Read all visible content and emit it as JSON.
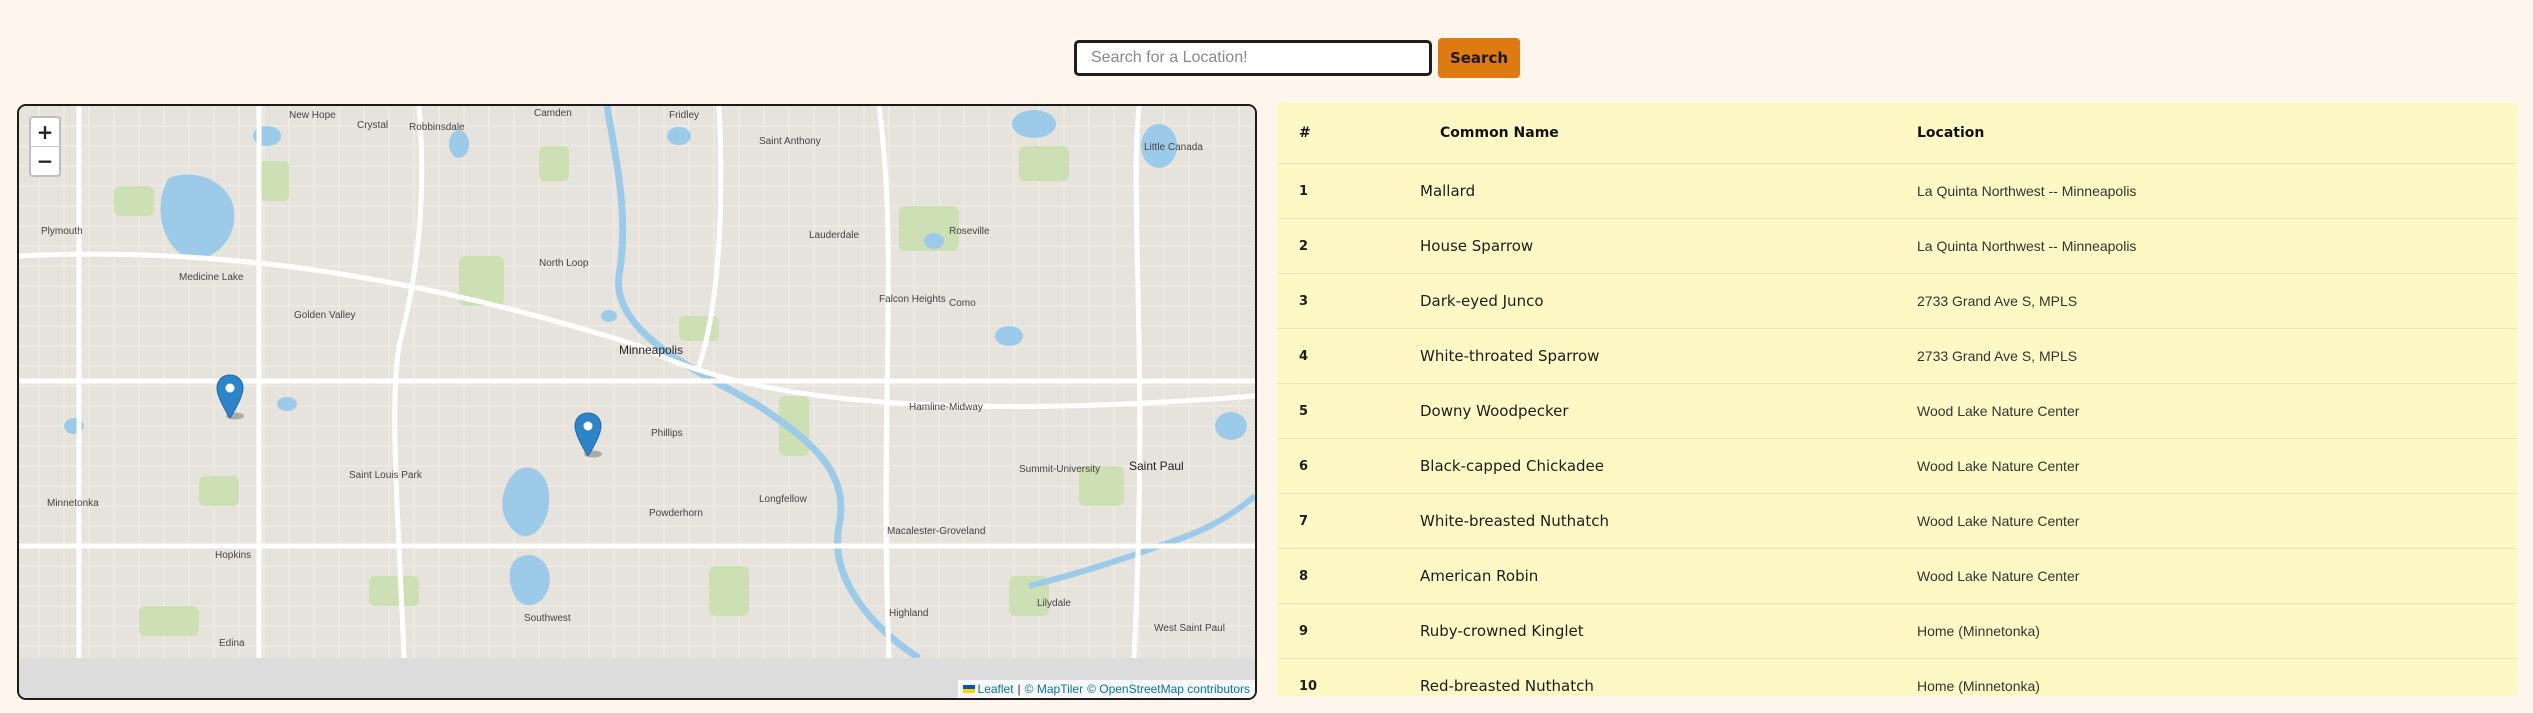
{
  "search": {
    "placeholder": "Search for a Location!",
    "button_label": "Search"
  },
  "map": {
    "zoom_in_label": "+",
    "zoom_out_label": "−",
    "attribution": {
      "leaflet": "Leaflet",
      "separator": "|",
      "copyright_1": "© MapTiler",
      "copyright_2": "© OpenStreetMap contributors"
    },
    "labels": {
      "new_hope": "New Hope",
      "crystal": "Crystal",
      "robbinsdale": "Robbinsdale",
      "camden": "Camden",
      "fridley": "Fridley",
      "saint_anthony": "Saint Anthony",
      "little_canada": "Little Canada",
      "plymouth": "Plymouth",
      "medicine_lake": "Medicine Lake",
      "golden_valley": "Golden Valley",
      "north_loop": "North Loop",
      "minneapolis": "Minneapolis",
      "lauderdale": "Lauderdale",
      "roseville": "Roseville",
      "falcon_heights": "Falcon Heights",
      "saint_louis_park": "Saint Louis Park",
      "minnetonka": "Minnetonka",
      "hopkins": "Hopkins",
      "phillips": "Phillips",
      "powderhorn": "Powderhorn",
      "longfellow": "Longfellow",
      "saint_paul": "Saint Paul",
      "macalester_groveland": "Macalester-Groveland",
      "highland": "Highland",
      "west_saint_paul": "West Saint Paul",
      "lilydale": "Lilydale",
      "southwest": "Southwest",
      "como": "Como",
      "hamline_midway": "Hamline-Midway",
      "summit_university": "Summit-University",
      "edina": "Edina"
    },
    "markers": [
      {
        "name": "marker-1"
      },
      {
        "name": "marker-2"
      }
    ],
    "colors": {
      "land": "#e6e3dc",
      "water": "#9ccbe9",
      "park": "#cde0b3",
      "road": "#ffffff",
      "marker": "#2d85c9"
    }
  },
  "table": {
    "headers": {
      "num": "#",
      "common_name": "Common Name",
      "location": "Location"
    },
    "rows": [
      {
        "num": "1",
        "name": "Mallard",
        "location": "La Quinta Northwest -- Minneapolis"
      },
      {
        "num": "2",
        "name": "House Sparrow",
        "location": "La Quinta Northwest -- Minneapolis"
      },
      {
        "num": "3",
        "name": "Dark-eyed Junco",
        "location": "2733 Grand Ave S, MPLS"
      },
      {
        "num": "4",
        "name": "White-throated Sparrow",
        "location": "2733 Grand Ave S, MPLS"
      },
      {
        "num": "5",
        "name": "Downy Woodpecker",
        "location": "Wood Lake Nature Center"
      },
      {
        "num": "6",
        "name": "Black-capped Chickadee",
        "location": "Wood Lake Nature Center"
      },
      {
        "num": "7",
        "name": "White-breasted Nuthatch",
        "location": "Wood Lake Nature Center"
      },
      {
        "num": "8",
        "name": "American Robin",
        "location": "Wood Lake Nature Center"
      },
      {
        "num": "9",
        "name": "Ruby-crowned Kinglet",
        "location": "Home (Minnetonka)"
      },
      {
        "num": "10",
        "name": "Red-breasted Nuthatch",
        "location": "Home (Minnetonka)"
      }
    ]
  },
  "colors": {
    "page_bg": "#fef5ec",
    "accent": "#de7a12",
    "table_bg": "#fef9c4"
  }
}
